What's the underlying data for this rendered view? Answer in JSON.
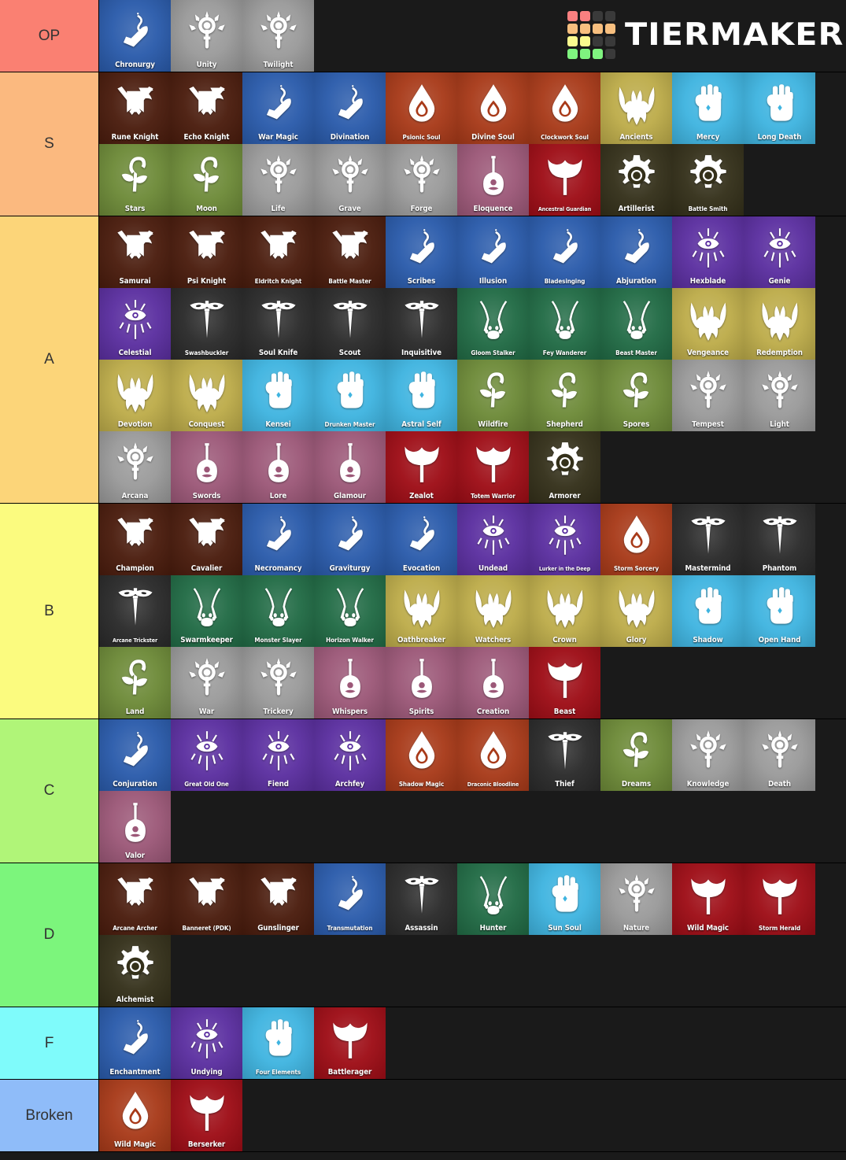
{
  "brand": {
    "name": "TIERMAKER",
    "logo_colors": [
      "#f98080",
      "#f98080",
      "#3a3a3a",
      "#3a3a3a",
      "#f7bf7f",
      "#f7bf7f",
      "#f7bf7f",
      "#f7bf7f",
      "#fafa8f",
      "#fafa8f",
      "#3a3a3a",
      "#3a3a3a",
      "#7ff37f",
      "#7ff37f",
      "#7ff37f",
      "#3a3a3a"
    ]
  },
  "class_styles": {
    "fighter": {
      "bg": "#4a1c0d",
      "icon": "banner-axe-sword-icon"
    },
    "wizard": {
      "bg": "#2a5bab",
      "icon": "magic-hand-icon"
    },
    "sorcerer": {
      "bg": "#a83a19",
      "icon": "flame-drop-icon"
    },
    "paladin": {
      "bg": "#bdac4a",
      "icon": "horned-helm-icon"
    },
    "monk": {
      "bg": "#3fb4e0",
      "icon": "fist-icon"
    },
    "druid": {
      "bg": "#6d8a38",
      "icon": "leaf-crook-icon"
    },
    "cleric": {
      "bg": "#9a9a9a",
      "icon": "sun-mace-icon"
    },
    "bard": {
      "bg": "#9c5878",
      "icon": "lute-icon"
    },
    "barbarian": {
      "bg": "#9e0d16",
      "icon": "battle-axe-icon"
    },
    "artificer": {
      "bg": "#34301a",
      "icon": "gear-icon"
    },
    "warlock": {
      "bg": "#5b2fa0",
      "icon": "eye-rays-icon"
    },
    "rogue": {
      "bg": "#2a2a2a",
      "icon": "dagger-wings-icon"
    },
    "ranger": {
      "bg": "#216b45",
      "icon": "crossed-bows-paw-icon"
    }
  },
  "tiers": [
    {
      "label": "OP",
      "color": "#fa8072",
      "items": [
        {
          "name": "Chronurgy",
          "class": "wizard"
        },
        {
          "name": "Unity",
          "class": "cleric"
        },
        {
          "name": "Twilight",
          "class": "cleric"
        }
      ]
    },
    {
      "label": "S",
      "color": "#fbb97f",
      "items": [
        {
          "name": "Rune Knight",
          "class": "fighter"
        },
        {
          "name": "Echo Knight",
          "class": "fighter"
        },
        {
          "name": "War Magic",
          "class": "wizard"
        },
        {
          "name": "Divination",
          "class": "wizard"
        },
        {
          "name": "Psionic Soul",
          "class": "sorcerer"
        },
        {
          "name": "Divine Soul",
          "class": "sorcerer"
        },
        {
          "name": "Clockwork Soul",
          "class": "sorcerer"
        },
        {
          "name": "Ancients",
          "class": "paladin"
        },
        {
          "name": "Mercy",
          "class": "monk"
        },
        {
          "name": "Long Death",
          "class": "monk"
        },
        {
          "name": "Stars",
          "class": "druid"
        },
        {
          "name": "Moon",
          "class": "druid"
        },
        {
          "name": "Life",
          "class": "cleric"
        },
        {
          "name": "Grave",
          "class": "cleric"
        },
        {
          "name": "Forge",
          "class": "cleric"
        },
        {
          "name": "Eloquence",
          "class": "bard"
        },
        {
          "name": "Ancestral Guardian",
          "class": "barbarian"
        },
        {
          "name": "Artillerist",
          "class": "artificer"
        },
        {
          "name": "Battle Smith",
          "class": "artificer"
        }
      ]
    },
    {
      "label": "A",
      "color": "#fcd579",
      "items": [
        {
          "name": "Samurai",
          "class": "fighter"
        },
        {
          "name": "Psi Knight",
          "class": "fighter"
        },
        {
          "name": "Eldritch Knight",
          "class": "fighter"
        },
        {
          "name": "Battle Master",
          "class": "fighter"
        },
        {
          "name": "Scribes",
          "class": "wizard"
        },
        {
          "name": "Illusion",
          "class": "wizard"
        },
        {
          "name": "Bladesinging",
          "class": "wizard"
        },
        {
          "name": "Abjuration",
          "class": "wizard"
        },
        {
          "name": "Hexblade",
          "class": "warlock"
        },
        {
          "name": "Genie",
          "class": "warlock"
        },
        {
          "name": "Celestial",
          "class": "warlock"
        },
        {
          "name": "Swashbuckler",
          "class": "rogue"
        },
        {
          "name": "Soul Knife",
          "class": "rogue"
        },
        {
          "name": "Scout",
          "class": "rogue"
        },
        {
          "name": "Inquisitive",
          "class": "rogue"
        },
        {
          "name": "Gloom Stalker",
          "class": "ranger"
        },
        {
          "name": "Fey Wanderer",
          "class": "ranger"
        },
        {
          "name": "Beast Master",
          "class": "ranger"
        },
        {
          "name": "Vengeance",
          "class": "paladin"
        },
        {
          "name": "Redemption",
          "class": "paladin"
        },
        {
          "name": "Devotion",
          "class": "paladin"
        },
        {
          "name": "Conquest",
          "class": "paladin"
        },
        {
          "name": "Kensei",
          "class": "monk"
        },
        {
          "name": "Drunken Master",
          "class": "monk"
        },
        {
          "name": "Astral Self",
          "class": "monk"
        },
        {
          "name": "Wildfire",
          "class": "druid"
        },
        {
          "name": "Shepherd",
          "class": "druid"
        },
        {
          "name": "Spores",
          "class": "druid"
        },
        {
          "name": "Tempest",
          "class": "cleric"
        },
        {
          "name": "Light",
          "class": "cleric"
        },
        {
          "name": "Arcana",
          "class": "cleric"
        },
        {
          "name": "Swords",
          "class": "bard"
        },
        {
          "name": "Lore",
          "class": "bard"
        },
        {
          "name": "Glamour",
          "class": "bard"
        },
        {
          "name": "Zealot",
          "class": "barbarian"
        },
        {
          "name": "Totem Warrior",
          "class": "barbarian"
        },
        {
          "name": "Armorer",
          "class": "artificer"
        }
      ]
    },
    {
      "label": "B",
      "color": "#fbfb7f",
      "items": [
        {
          "name": "Champion",
          "class": "fighter"
        },
        {
          "name": "Cavalier",
          "class": "fighter"
        },
        {
          "name": "Necromancy",
          "class": "wizard"
        },
        {
          "name": "Graviturgy",
          "class": "wizard"
        },
        {
          "name": "Evocation",
          "class": "wizard"
        },
        {
          "name": "Undead",
          "class": "warlock"
        },
        {
          "name": "Lurker in the Deep",
          "class": "warlock"
        },
        {
          "name": "Storm Sorcery",
          "class": "sorcerer"
        },
        {
          "name": "Mastermind",
          "class": "rogue"
        },
        {
          "name": "Phantom",
          "class": "rogue"
        },
        {
          "name": "Arcane Trickster",
          "class": "rogue"
        },
        {
          "name": "Swarmkeeper",
          "class": "ranger"
        },
        {
          "name": "Monster Slayer",
          "class": "ranger"
        },
        {
          "name": "Horizon Walker",
          "class": "ranger"
        },
        {
          "name": "Oathbreaker",
          "class": "paladin"
        },
        {
          "name": "Watchers",
          "class": "paladin"
        },
        {
          "name": "Crown",
          "class": "paladin"
        },
        {
          "name": "Glory",
          "class": "paladin"
        },
        {
          "name": "Shadow",
          "class": "monk"
        },
        {
          "name": "Open Hand",
          "class": "monk"
        },
        {
          "name": "Land",
          "class": "druid"
        },
        {
          "name": "War",
          "class": "cleric"
        },
        {
          "name": "Trickery",
          "class": "cleric"
        },
        {
          "name": "Whispers",
          "class": "bard"
        },
        {
          "name": "Spirits",
          "class": "bard"
        },
        {
          "name": "Creation",
          "class": "bard"
        },
        {
          "name": "Beast",
          "class": "barbarian"
        }
      ]
    },
    {
      "label": "C",
      "color": "#b0f578",
      "items": [
        {
          "name": "Conjuration",
          "class": "wizard"
        },
        {
          "name": "Great Old One",
          "class": "warlock"
        },
        {
          "name": "Fiend",
          "class": "warlock"
        },
        {
          "name": "Archfey",
          "class": "warlock"
        },
        {
          "name": "Shadow Magic",
          "class": "sorcerer"
        },
        {
          "name": "Draconic Bloodline",
          "class": "sorcerer"
        },
        {
          "name": "Thief",
          "class": "rogue"
        },
        {
          "name": "Dreams",
          "class": "druid"
        },
        {
          "name": "Knowledge",
          "class": "cleric"
        },
        {
          "name": "Death",
          "class": "cleric"
        },
        {
          "name": "Valor",
          "class": "bard"
        }
      ]
    },
    {
      "label": "D",
      "color": "#7cf57c",
      "items": [
        {
          "name": "Arcane Archer",
          "class": "fighter"
        },
        {
          "name": "Banneret (PDK)",
          "class": "fighter"
        },
        {
          "name": "Gunslinger",
          "class": "fighter"
        },
        {
          "name": "Transmutation",
          "class": "wizard"
        },
        {
          "name": "Assassin",
          "class": "rogue"
        },
        {
          "name": "Hunter",
          "class": "ranger"
        },
        {
          "name": "Sun Soul",
          "class": "monk"
        },
        {
          "name": "Nature",
          "class": "cleric"
        },
        {
          "name": "Wild Magic",
          "class": "barbarian"
        },
        {
          "name": "Storm Herald",
          "class": "barbarian"
        },
        {
          "name": "Alchemist",
          "class": "artificer"
        }
      ]
    },
    {
      "label": "F",
      "color": "#7ffbfb",
      "items": [
        {
          "name": "Enchantment",
          "class": "wizard"
        },
        {
          "name": "Undying",
          "class": "warlock"
        },
        {
          "name": "Four Elements",
          "class": "monk"
        },
        {
          "name": "Battlerager",
          "class": "barbarian"
        }
      ]
    },
    {
      "label": "Broken",
      "color": "#8fbcf9",
      "items": [
        {
          "name": "Wild Magic",
          "class": "sorcerer"
        },
        {
          "name": "Berserker",
          "class": "barbarian"
        }
      ]
    }
  ]
}
